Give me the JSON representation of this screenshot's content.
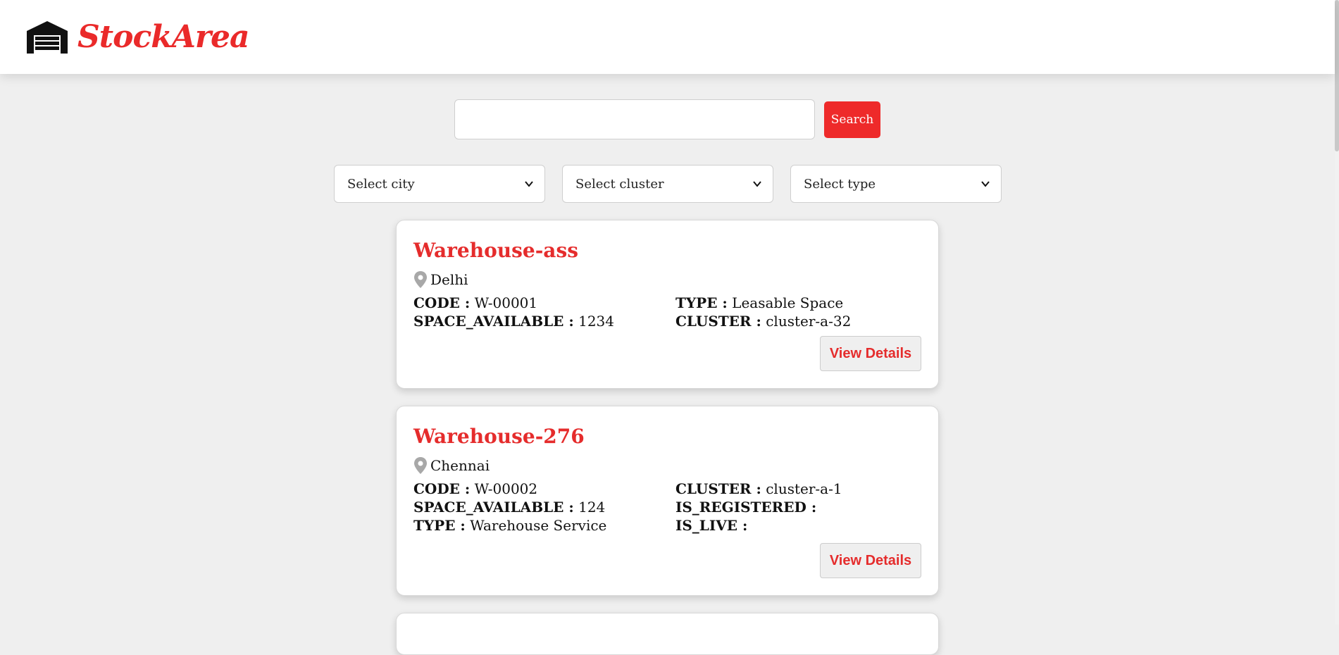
{
  "brand": {
    "name": "StockArea",
    "icon": "warehouse-icon",
    "accent": "#ea2a2a"
  },
  "search": {
    "value": "",
    "placeholder": "",
    "button_label": "Search"
  },
  "filters": {
    "city": "Select city",
    "cluster": "Select cluster",
    "type": "Select type"
  },
  "cards": [
    {
      "title": "Warehouse-ass",
      "location": "Delhi",
      "fields": [
        {
          "key": "CODE :",
          "value": "W-00001"
        },
        {
          "key": "TYPE :",
          "value": "Leasable Space"
        },
        {
          "key": "SPACE_AVAILABLE :",
          "value": "1234"
        },
        {
          "key": "CLUSTER :",
          "value": "cluster-a-32"
        }
      ],
      "button_label": "View Details"
    },
    {
      "title": "Warehouse-276",
      "location": "Chennai",
      "fields": [
        {
          "key": "CODE :",
          "value": "W-00002"
        },
        {
          "key": "CLUSTER :",
          "value": "cluster-a-1"
        },
        {
          "key": "SPACE_AVAILABLE :",
          "value": "124"
        },
        {
          "key": "IS_REGISTERED :",
          "value": ""
        },
        {
          "key": "TYPE :",
          "value": "Warehouse Service"
        },
        {
          "key": "IS_LIVE :",
          "value": ""
        }
      ],
      "button_label": "View Details"
    }
  ]
}
